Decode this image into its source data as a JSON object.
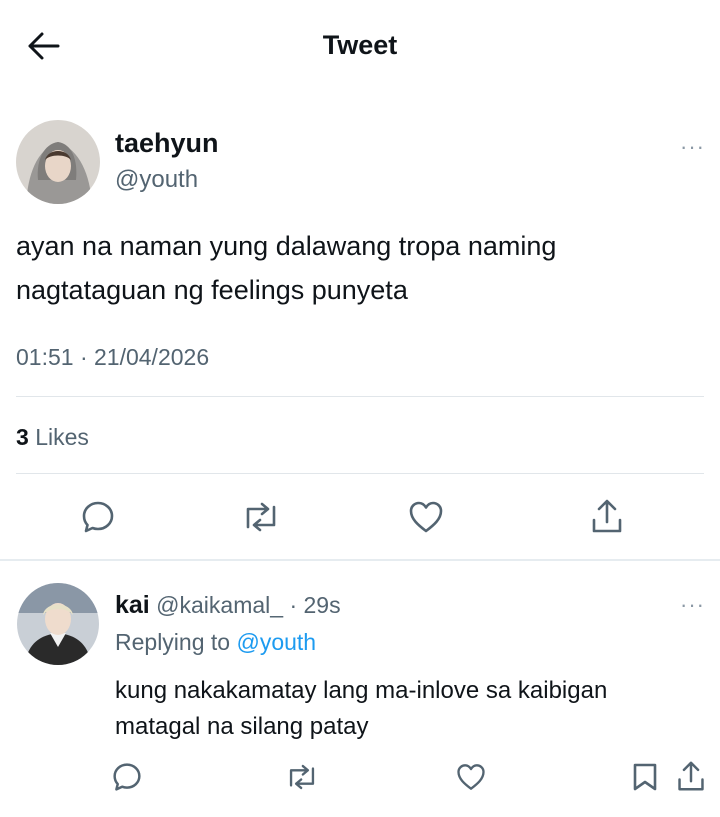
{
  "header": {
    "title": "Tweet",
    "back_icon": "arrow-left-icon"
  },
  "tweet": {
    "author_name": "taehyun",
    "author_handle": "@youth",
    "text_line1": "ayan na naman yung dalawang tropa naming",
    "text_line2": "nagtataguan ng feelings punyeta",
    "timestamp": "01:51 · 21/04/2026",
    "likes_count": "3",
    "likes_label": "Likes",
    "actions": [
      "reply-icon",
      "retweet-icon",
      "like-icon",
      "share-icon"
    ]
  },
  "reply": {
    "author_name": "kai",
    "author_handle": "@kaikamal_",
    "age": "· 29s",
    "replying_prefix": "Replying to",
    "replying_to": "@youth",
    "text_line1": "kung nakakamatay lang ma-inlove sa kaibigan",
    "text_line2": "matagal na silang patay",
    "actions": [
      "reply-icon",
      "retweet-icon",
      "like-icon",
      "bookmark-icon",
      "share-icon"
    ]
  },
  "more_label": "···",
  "colors": {
    "link": "#1d9bf0",
    "secondary": "#536471",
    "text": "#0f1419",
    "divider": "#e1e6ea"
  }
}
